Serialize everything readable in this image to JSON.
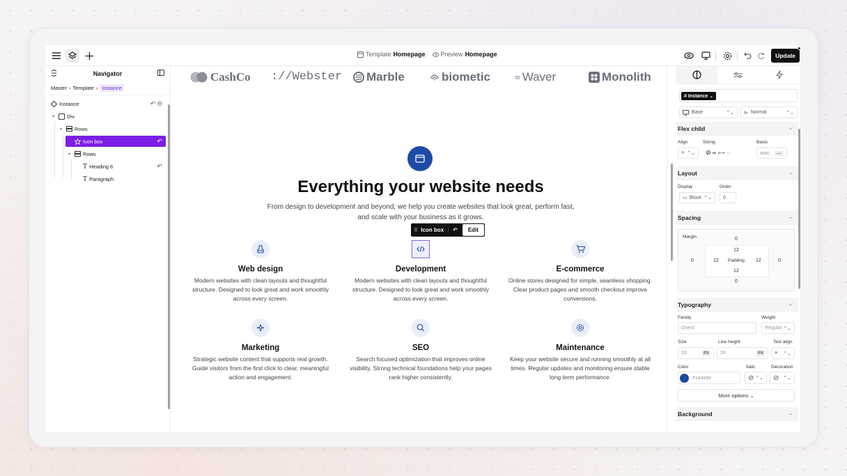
{
  "topbar": {
    "template_label": "Template",
    "template_value": "Homepage",
    "preview_label": "Preview",
    "preview_value": "Homepage",
    "update_label": "Update"
  },
  "navigator": {
    "title": "Navigator",
    "breadcrumb": [
      "Master",
      "Template",
      "Instance"
    ],
    "tree": [
      {
        "label": "Instance",
        "icon": "diamond-icon"
      },
      {
        "label": "Div",
        "icon": "square-icon"
      },
      {
        "label": "Rows",
        "icon": "rows-icon"
      },
      {
        "label": "Icon box",
        "icon": "star-icon",
        "selected": true
      },
      {
        "label": "Rows",
        "icon": "rows-icon"
      },
      {
        "label": "Heading 6",
        "icon": "text-icon"
      },
      {
        "label": "Paragraph",
        "icon": "text-icon"
      }
    ]
  },
  "canvas": {
    "logos": [
      "CashCo",
      "://Webster",
      "Marble",
      "biometic",
      "Waver",
      "Monolith"
    ],
    "hero_title": "Everything your website needs",
    "hero_subtitle": "From design to development and beyond, we help you create websites that look great, perform fast, and scale with your business as it grows.",
    "iconbox_toolbar": {
      "label": "Icon box",
      "edit": "Edit"
    },
    "features": [
      {
        "title": "Web design",
        "desc": "Modern websites with clean layouts and thoughtful structure. Designed to look great and work smoothly across every screen.",
        "icon": "paint-brush-icon"
      },
      {
        "title": "Development",
        "desc": "Modern websites with clean layouts and thoughtful structure. Designed to look great and work smoothly across every screen.",
        "icon": "code-icon"
      },
      {
        "title": "E-commerce",
        "desc": "Online stores designed for simple, seamless shopping. Clear product pages and smooth checkout improve conversions.",
        "icon": "cart-icon"
      },
      {
        "title": "Marketing",
        "desc": "Strategic website content that supports real growth. Guide visitors from the first click to clear, meaningful action and engagement.",
        "icon": "sparkle-icon"
      },
      {
        "title": "SEO",
        "desc": "Search focused optimization that improves online visibility. Strong technical foundations help your pages rank higher consistently.",
        "icon": "search-icon"
      },
      {
        "title": "Maintenance",
        "desc": "Keep your website secure and running smoothly at all times. Regular updates and monitoring ensure stable long term performance.",
        "icon": "gear-icon"
      }
    ]
  },
  "panel": {
    "class_tag": "# Instance",
    "breakpoint": "Base",
    "state": "Normal",
    "flex_child": {
      "title": "Flex child",
      "align_label": "Align",
      "sizing_label": "Sizing",
      "basis_label": "Basis",
      "basis_value": "auto"
    },
    "layout": {
      "title": "Layout",
      "display_label": "Display",
      "display_value": "Block",
      "order_label": "Order",
      "order_value": "0"
    },
    "spacing": {
      "title": "Spacing",
      "margin_label": "Margin",
      "margin_top": "0",
      "margin_left": "0",
      "margin_right": "0",
      "margin_bottom": "0",
      "padding_label": "Padding",
      "padding_top": "12",
      "padding_left": "12",
      "padding_right": "12",
      "padding_bottom": "12"
    },
    "typography": {
      "title": "Typography",
      "family_label": "Family",
      "family_value": "Onest",
      "weight_label": "Weight",
      "weight_value": "Regular",
      "size_label": "Size",
      "size_value": "16",
      "size_unit": "PX",
      "lh_label": "Line height",
      "lh_value": "24",
      "lh_unit": "PX",
      "align_label": "Text align",
      "color_label": "Color",
      "color_value": "#1a4a9e",
      "italic_label": "Italic",
      "decoration_label": "Decoration",
      "more_options": "More options"
    },
    "background": {
      "title": "Background"
    }
  }
}
